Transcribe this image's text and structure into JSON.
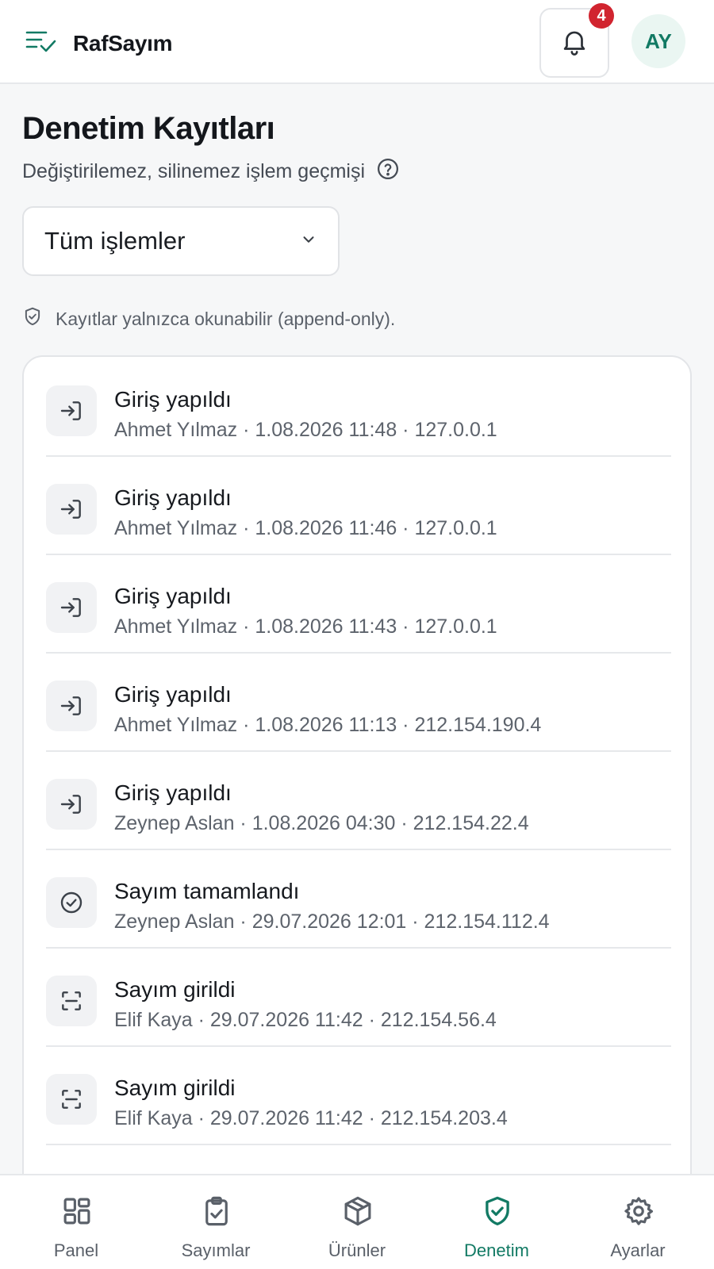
{
  "header": {
    "brand": "RafSayım",
    "notifications_count": "4",
    "avatar_initials": "AY"
  },
  "page": {
    "title": "Denetim Kayıtları",
    "subtitle": "Değiştirilemez, silinemez işlem geçmişi",
    "filter_value": "Tüm işlemler",
    "notice": "Kayıtlar yalnızca okunabilir (append-only)."
  },
  "logs": [
    {
      "title": "Giriş yapıldı",
      "meta": "Ahmet Yılmaz · 1.08.2026 11:48 · 127.0.0.1",
      "icon": "login-icon"
    },
    {
      "title": "Giriş yapıldı",
      "meta": "Ahmet Yılmaz · 1.08.2026 11:46 · 127.0.0.1",
      "icon": "login-icon"
    },
    {
      "title": "Giriş yapıldı",
      "meta": "Ahmet Yılmaz · 1.08.2026 11:43 · 127.0.0.1",
      "icon": "login-icon"
    },
    {
      "title": "Giriş yapıldı",
      "meta": "Ahmet Yılmaz · 1.08.2026 11:13 · 212.154.190.4",
      "icon": "login-icon"
    },
    {
      "title": "Giriş yapıldı",
      "meta": "Zeynep Aslan · 1.08.2026 04:30 · 212.154.22.4",
      "icon": "login-icon"
    },
    {
      "title": "Sayım tamamlandı",
      "meta": "Zeynep Aslan · 29.07.2026 12:01 · 212.154.112.4",
      "icon": "check-circle-icon"
    },
    {
      "title": "Sayım girildi",
      "meta": "Elif Kaya · 29.07.2026 11:42 · 212.154.56.4",
      "icon": "scan-icon"
    },
    {
      "title": "Sayım girildi",
      "meta": "Elif Kaya · 29.07.2026 11:42 · 212.154.203.4",
      "icon": "scan-icon"
    }
  ],
  "nav": [
    {
      "label": "Panel",
      "icon": "grid-icon",
      "active": false
    },
    {
      "label": "Sayımlar",
      "icon": "clipboard-check-icon",
      "active": false
    },
    {
      "label": "Ürünler",
      "icon": "box-icon",
      "active": false
    },
    {
      "label": "Denetim",
      "icon": "shield-check-icon",
      "active": true
    },
    {
      "label": "Ayarlar",
      "icon": "gear-icon",
      "active": false
    }
  ],
  "colors": {
    "accent": "#127a64",
    "badge": "#d1242f"
  }
}
